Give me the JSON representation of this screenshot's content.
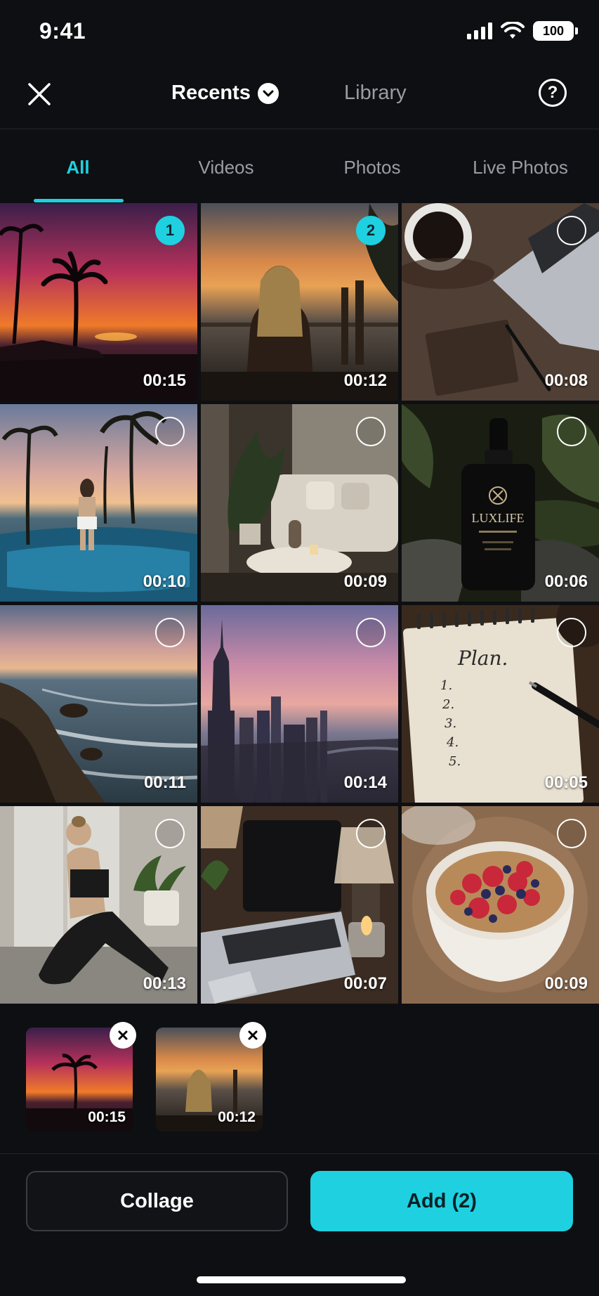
{
  "status_bar": {
    "time": "9:41",
    "battery": "100"
  },
  "header": {
    "title": "Recents",
    "library": "Library"
  },
  "tabs": [
    {
      "label": "All",
      "active": true
    },
    {
      "label": "Videos",
      "active": false
    },
    {
      "label": "Photos",
      "active": false
    },
    {
      "label": "Live Photos",
      "active": false
    }
  ],
  "grid": [
    {
      "scene": "palm-sunset",
      "duration": "00:15",
      "selection": "1"
    },
    {
      "scene": "woman-sunset",
      "duration": "00:12",
      "selection": "2"
    },
    {
      "scene": "coffee-laptop",
      "duration": "00:08",
      "selection": ""
    },
    {
      "scene": "pool-palms",
      "duration": "00:10",
      "selection": ""
    },
    {
      "scene": "living-room",
      "duration": "00:09",
      "selection": ""
    },
    {
      "scene": "serum-bottle",
      "duration": "00:06",
      "selection": "",
      "label": "LUXLIFE"
    },
    {
      "scene": "rocky-coast",
      "duration": "00:11",
      "selection": ""
    },
    {
      "scene": "city-skyline",
      "duration": "00:14",
      "selection": ""
    },
    {
      "scene": "notebook-plan",
      "duration": "00:05",
      "selection": "",
      "notebook_title": "Plan.",
      "notebook_lines": [
        "1.",
        "2.",
        "3.",
        "4.",
        "5."
      ]
    },
    {
      "scene": "yoga-woman",
      "duration": "00:13",
      "selection": ""
    },
    {
      "scene": "laptop-candle",
      "duration": "00:07",
      "selection": ""
    },
    {
      "scene": "berry-bowl",
      "duration": "00:09",
      "selection": ""
    }
  ],
  "tray": [
    {
      "scene": "palm-sunset",
      "duration": "00:15"
    },
    {
      "scene": "woman-sunset",
      "duration": "00:12"
    }
  ],
  "buttons": {
    "collage": "Collage",
    "add": "Add (2)"
  },
  "colors": {
    "accent": "#1fd0e0",
    "background": "#0e0f12"
  }
}
